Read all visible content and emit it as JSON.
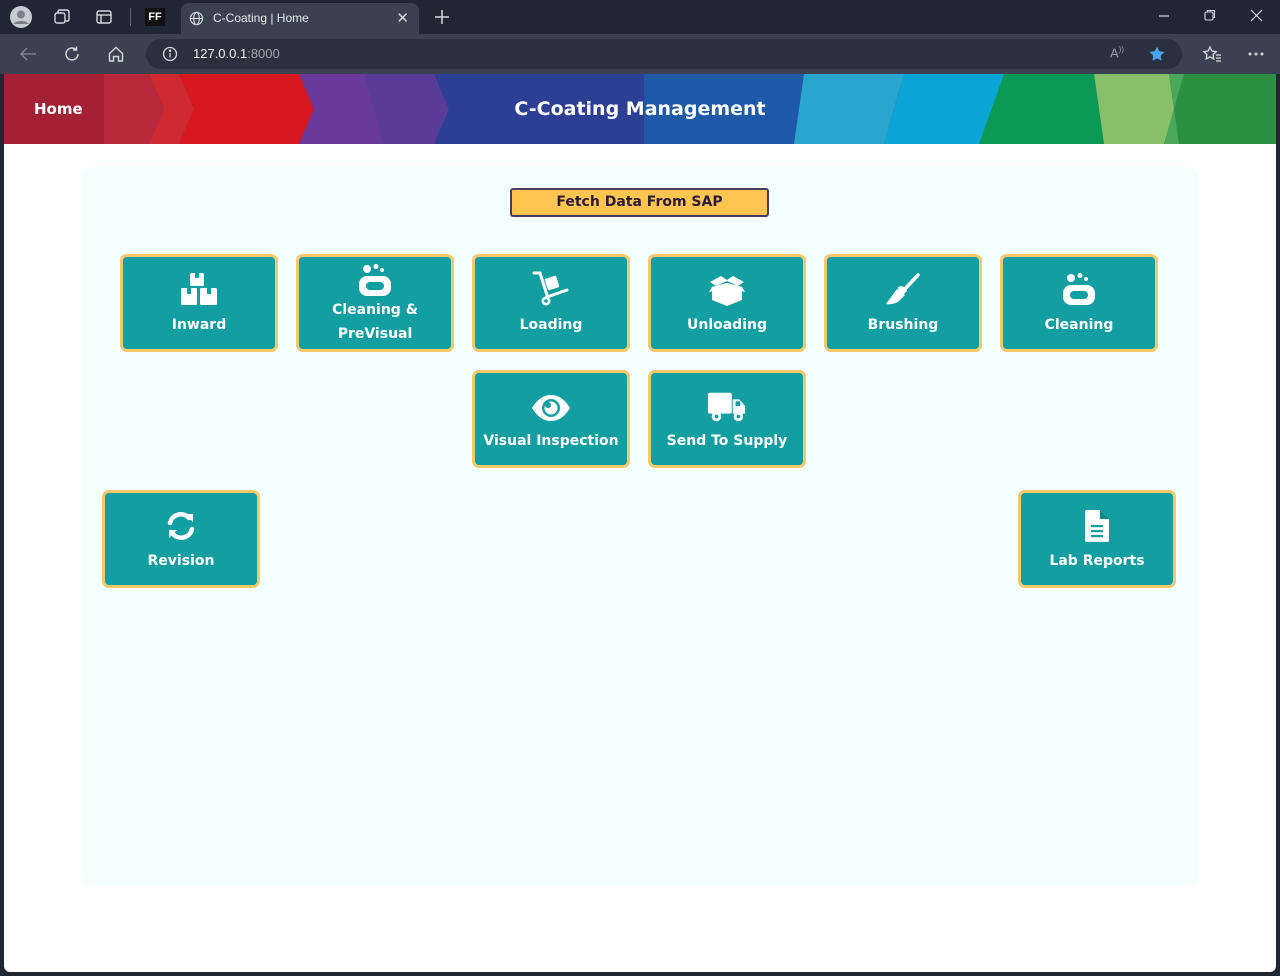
{
  "browser": {
    "tab_title": "C-Coating | Home",
    "url_host": "127.0.0.1",
    "url_port": ":8000",
    "profile_icon": "profile-avatar-icon",
    "workspaces_icon": "workspaces-icon",
    "tab_actions_icon": "tab-actions-icon",
    "pinned_tab_label": "FF"
  },
  "header": {
    "home_label": "Home",
    "title": "C-Coating Management"
  },
  "actions": {
    "fetch_label": "Fetch Data From SAP"
  },
  "tiles": [
    {
      "label": "Inward",
      "icon": "boxes-icon"
    },
    {
      "label": "Cleaning &\nPreVisual",
      "icon": "soap-icon"
    },
    {
      "label": "Loading",
      "icon": "dolly-icon"
    },
    {
      "label": "Unloading",
      "icon": "open-box-icon"
    },
    {
      "label": "Brushing",
      "icon": "broom-icon"
    },
    {
      "label": "Cleaning",
      "icon": "soap-icon"
    },
    {
      "label": "Visual Inspection",
      "icon": "eye-icon"
    },
    {
      "label": "Send To Supply",
      "icon": "truck-icon"
    },
    {
      "label": "Revision",
      "icon": "refresh-icon"
    },
    {
      "label": "Lab Reports",
      "icon": "document-icon"
    }
  ],
  "colors": {
    "tile_bg": "#139ea2",
    "tile_border": "#f5c96a",
    "fetch_bg": "#ffc64f",
    "panel_bg": "#f2fffd"
  }
}
